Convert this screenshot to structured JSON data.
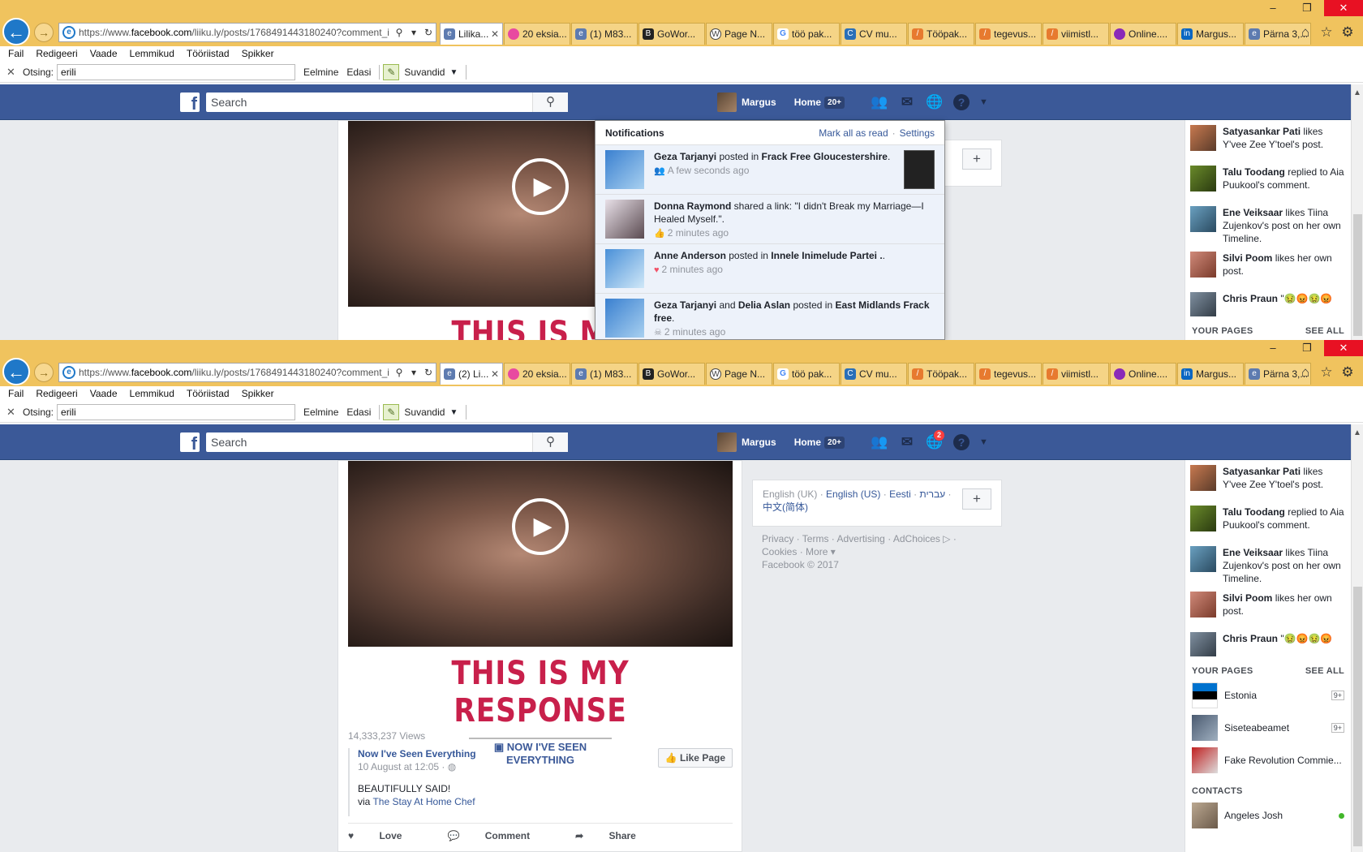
{
  "browser": {
    "url_prefix": "https://www.",
    "url_host": "facebook.com",
    "url_path": "/liiku.ly/posts/1768491443180240?comment_i",
    "tabs": [
      {
        "label": "Lilika...",
        "icon": "ie-icon"
      },
      {
        "label": "20 eksia...",
        "icon": "dot-icon"
      },
      {
        "label": "(1) M83...",
        "icon": "ie-icon"
      },
      {
        "label": "GoWor...",
        "icon": "gw-icon"
      },
      {
        "label": "Page N...",
        "icon": "wordpress-icon"
      },
      {
        "label": "töö pak...",
        "icon": "google-icon"
      },
      {
        "label": "CV mu...",
        "icon": "cv-icon"
      },
      {
        "label": "Tööpak...",
        "icon": "feather-icon"
      },
      {
        "label": "tegevus...",
        "icon": "feather-icon"
      },
      {
        "label": "viimistl...",
        "icon": "feather-icon"
      },
      {
        "label": "Online....",
        "icon": "cloud-icon"
      },
      {
        "label": "Margus...",
        "icon": "linkedin-icon"
      },
      {
        "label": "Pärna 3,...",
        "icon": "ie-icon"
      }
    ],
    "tabs_second": {
      "first_label": "(2) Li..."
    },
    "menu": [
      "Fail",
      "Redigeeri",
      "Vaade",
      "Lemmikud",
      "Tööriistad",
      "Spikker"
    ],
    "find": {
      "label": "Otsing:",
      "value": "erili",
      "prev": "Eelmine",
      "next": "Edasi",
      "options": "Suvandid"
    }
  },
  "facebook": {
    "search_placeholder": "Search",
    "user_name": "Margus",
    "home_label": "Home",
    "home_badge": "20+",
    "notif_badge": "2"
  },
  "notifications": {
    "title": "Notifications",
    "mark_all": "Mark all as read",
    "settings": "Settings",
    "items": [
      {
        "actor": "Geza Tarjanyi",
        "action": " posted in ",
        "target": "Frack Free Gloucestershire",
        "end": ".",
        "time": "A few seconds ago",
        "type_icon": "group-icon"
      },
      {
        "actor": "Donna Raymond",
        "action": " shared a link: \"I didn't Break my Marriage—I Healed Myself.\".",
        "target": "",
        "end": "",
        "time": "2 minutes ago",
        "type_icon": "share-icon"
      },
      {
        "actor": "Anne Anderson",
        "action": " posted in ",
        "target": "Innele Inimelude Partei .",
        "end": ".",
        "time": "2 minutes ago",
        "type_icon": "heart-icon"
      },
      {
        "actor": "Geza Tarjanyi",
        "action": " and ",
        "target": "Delia Aslan",
        "action2": " posted in ",
        "target2": "East Midlands Frack free",
        "end": ".",
        "time": "2 minutes ago",
        "type_icon": "skull-icon"
      }
    ]
  },
  "post": {
    "headline": "THIS IS MY RESPONSE",
    "subline": "NOW I'VE SEEN EVERYTHING",
    "views": "14,333,237 Views",
    "page_name": "Now I've Seen Everything",
    "page_date": "10 August at 12:05 · ",
    "like_page": "Like Page",
    "text": "BEAUTIFULLY SAID!",
    "via": "via ",
    "via_link": "The Stay At Home Chef",
    "actions": {
      "love": "Love",
      "comment": "Comment",
      "share": "Share"
    }
  },
  "languages": {
    "current": "English (UK)",
    "others": [
      "English (US)",
      "Eesti",
      "עברית",
      "中文(简体)"
    ]
  },
  "footer": {
    "links": [
      "Privacy",
      "Terms",
      "Advertising",
      "AdChoices",
      "Cookies",
      "More"
    ],
    "copyright": "Facebook © 2017"
  },
  "ticker": [
    {
      "actor": "Satyasankar Pati",
      "text": " likes Y'vee Zee Y'toel's post."
    },
    {
      "actor": "Talu Toodang",
      "text": " replied to Aia Puukool's comment."
    },
    {
      "actor": "Ene Veiksaar",
      "text": " likes Tiina Zujenkov's post on her own Timeline."
    },
    {
      "actor": "Silvi Poom",
      "text": " likes her own post."
    },
    {
      "actor": "Chris Praun",
      "text": " \""
    }
  ],
  "your_pages": {
    "title": "YOUR PAGES",
    "see_all": "SEE ALL",
    "items": [
      {
        "name": "Estonia",
        "count": "9+"
      },
      {
        "name": "Siseteabeamet",
        "count": "9+"
      },
      {
        "name": "Fake Revolution Commie...",
        "count": ""
      }
    ]
  },
  "contacts": {
    "title": "CONTACTS",
    "items": [
      {
        "name": "Angeles Josh"
      }
    ]
  },
  "colors": {
    "fb_blue": "#3b5998",
    "titlebar": "#f0c35e",
    "headline_red": "#c8204b"
  }
}
